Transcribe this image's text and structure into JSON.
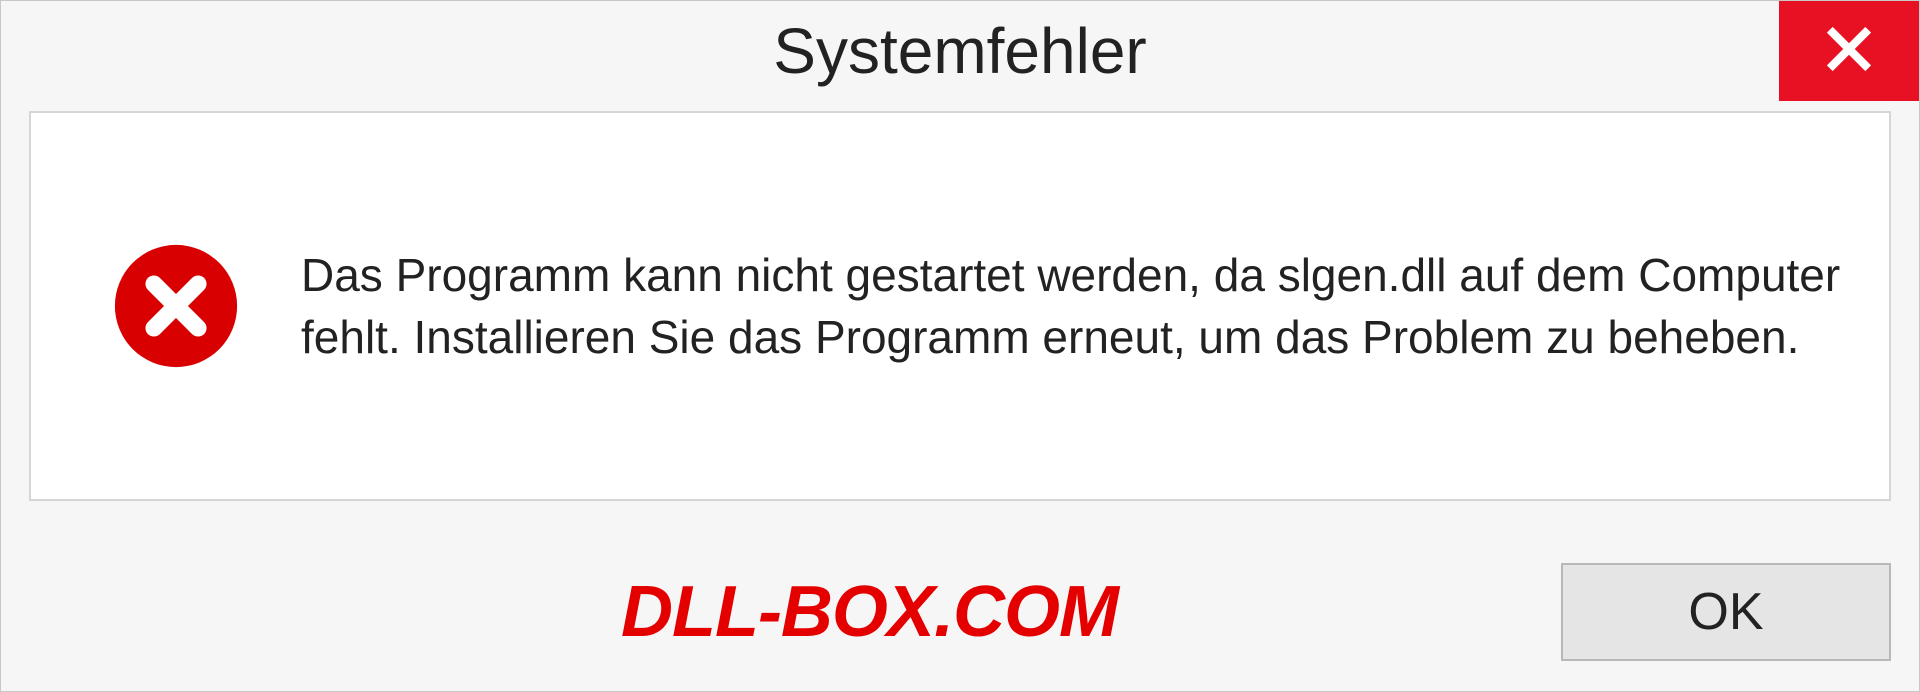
{
  "dialog": {
    "title": "Systemfehler",
    "message": "Das Programm kann nicht gestartet werden, da slgen.dll auf dem Computer fehlt. Installieren Sie das Programm erneut, um das Problem zu beheben.",
    "ok_label": "OK"
  },
  "watermark": "DLL-BOX.COM",
  "colors": {
    "close_bg": "#e81123",
    "watermark": "#e50000"
  }
}
